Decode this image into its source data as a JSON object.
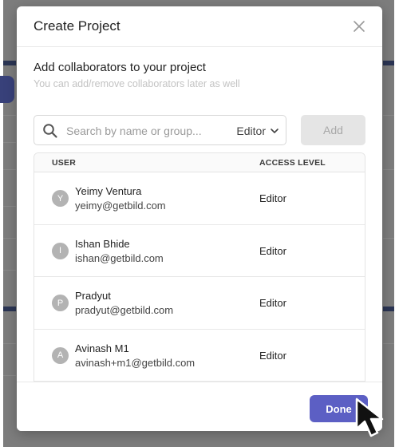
{
  "modal": {
    "title": "Create Project",
    "section_title": "Add collaborators to your project",
    "section_subtitle": "You can add/remove collaborators later as well"
  },
  "search": {
    "placeholder": "Search by name or group...",
    "role_selected": "Editor",
    "add_label": "Add"
  },
  "table": {
    "headers": {
      "user": "USER",
      "access": "ACCESS LEVEL"
    },
    "rows": [
      {
        "initial": "Y",
        "name": "Yeimy Ventura",
        "email": "yeimy@getbild.com",
        "access": "Editor"
      },
      {
        "initial": "I",
        "name": "Ishan Bhide",
        "email": "ishan@getbild.com",
        "access": "Editor"
      },
      {
        "initial": "P",
        "name": "Pradyut",
        "email": "pradyut@getbild.com",
        "access": "Editor"
      },
      {
        "initial": "A",
        "name": "Avinash M1",
        "email": "avinash+m1@getbild.com",
        "access": "Editor"
      }
    ]
  },
  "footer": {
    "done_label": "Done"
  },
  "colors": {
    "primary": "#5c5fc4",
    "avatar": "#b3b3b3",
    "disabled_button": "#e5e5e5"
  }
}
